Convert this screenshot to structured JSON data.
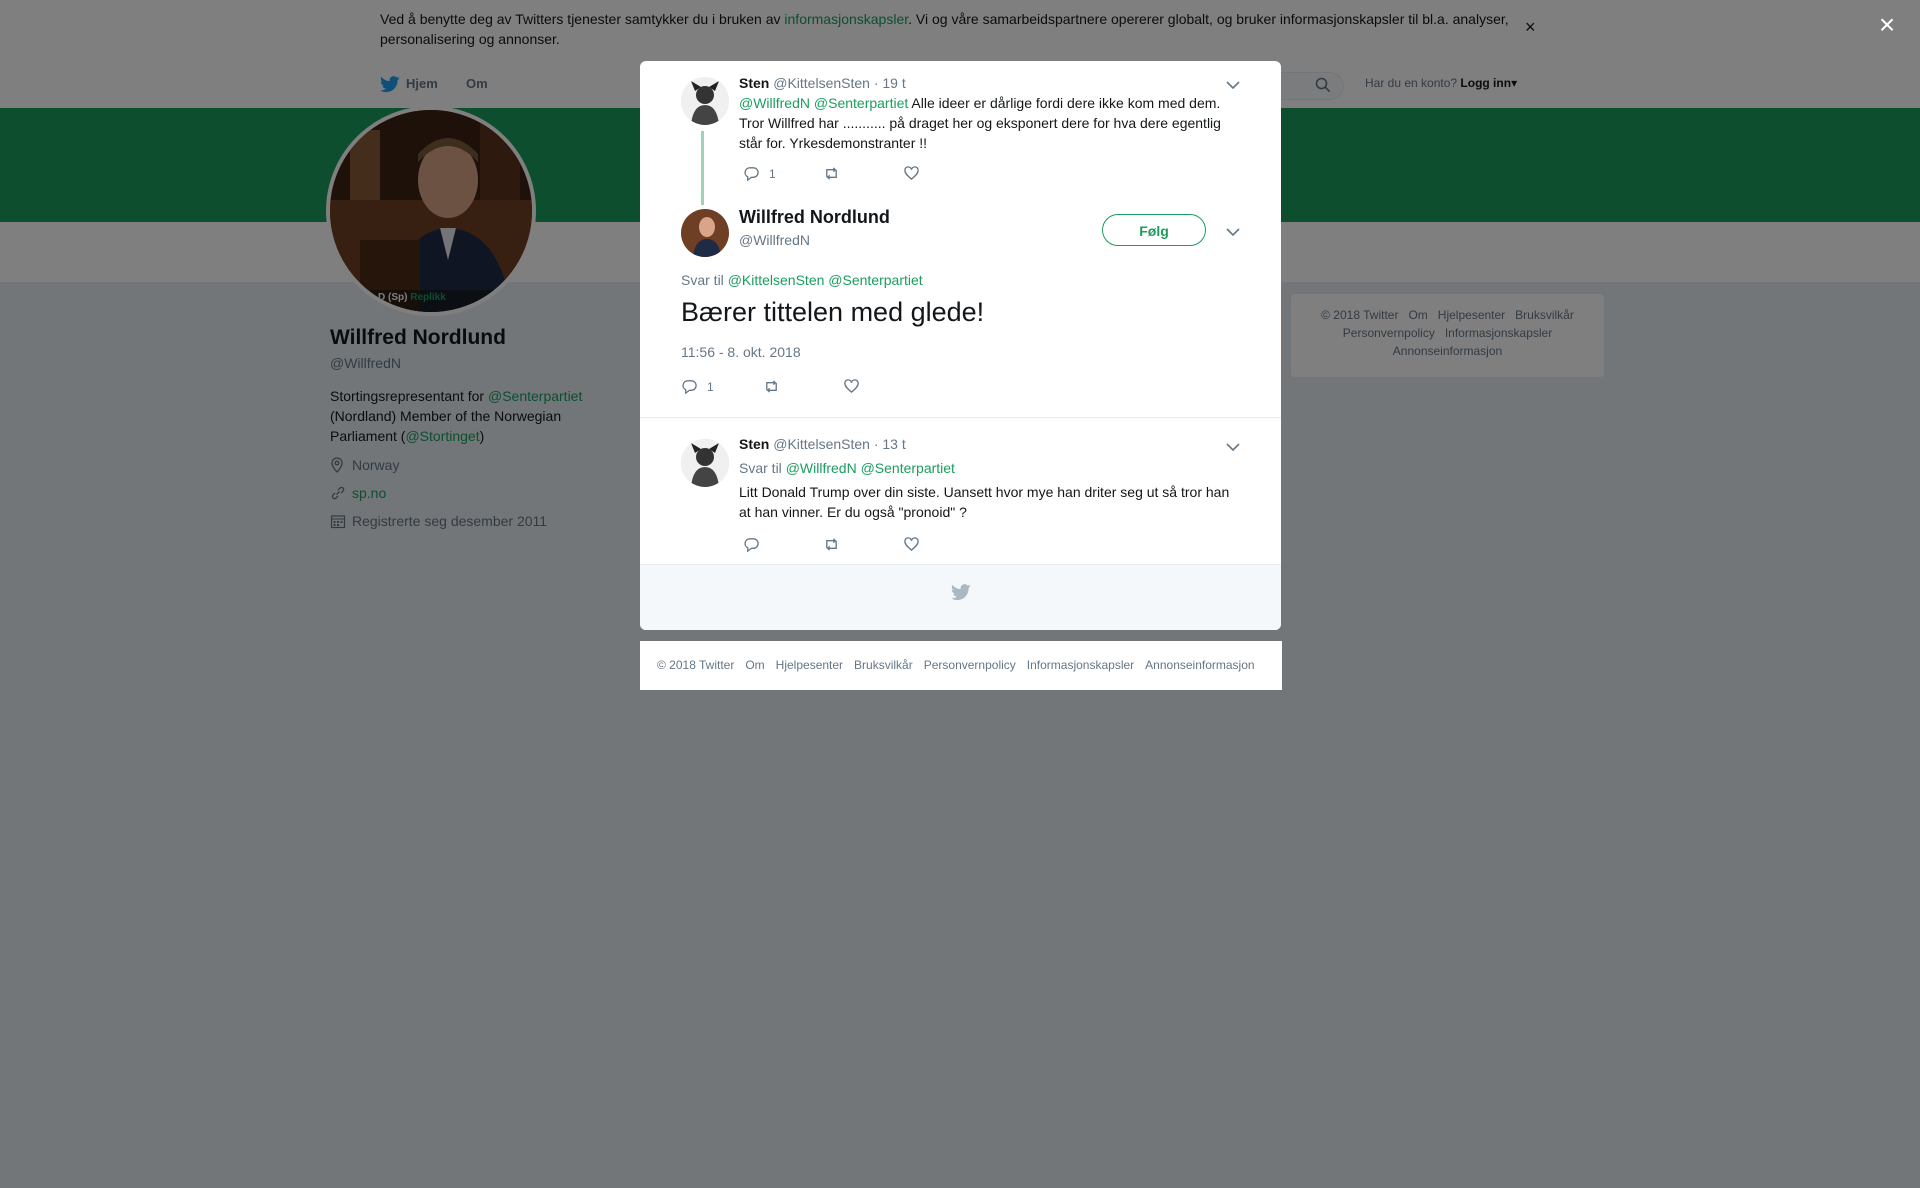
{
  "cookie_banner": {
    "text_before": "Ved å benytte deg av Twitters tjenester samtykker du i bruken av ",
    "link": "informasjonskapsler",
    "text_after": ". Vi og våre samarbeidspartnere opererer globalt, og bruker informasjonskapsler til bl.a. analyser, personalisering og annonser.",
    "close": "×"
  },
  "nav": {
    "home": "Hjem",
    "about": "Om",
    "login_question": "Har du en konto?",
    "login": "Logg inn"
  },
  "profile": {
    "avatar_caption": "D (Sp)",
    "avatar_caption_accent": "Replikk",
    "name": "Willfred Nordlund",
    "handle": "@WillfredN",
    "bio_1": "Stortingsrepresentant for ",
    "bio_link_1": "@Senterpartiet",
    "bio_2": " (Nordland) Member of the Norwegian Parliament (",
    "bio_link_2": "@Stortinget",
    "bio_3": ")",
    "location": "Norway",
    "website": "sp.no",
    "joined": "Registrerte seg desember 2011"
  },
  "side_footer": {
    "items": [
      "© 2018 Twitter",
      "Om",
      "Hjelpesenter",
      "Bruksvilkår",
      "Personvernpolicy",
      "Informasjonskapsler",
      "Annonseinformasjon"
    ]
  },
  "modal": {
    "close": "×",
    "parent_tweet": {
      "name": "Sten",
      "handle": "@KittelsenSten",
      "time": "· 19 t",
      "mention_1": "@WillfredN",
      "mention_2": "@Senterpartiet",
      "text": " Alle ideer er dårlige fordi dere ikke kom med dem. Tror Willfred har ........... på draget her og eksponert dere for hva dere egentlig står for. Yrkesdemonstranter !!",
      "replies": "1"
    },
    "main_tweet": {
      "name": "Willfred Nordlund",
      "handle": "@WillfredN",
      "follow": "Følg",
      "reply_to_label": "Svar til",
      "reply_to_1": "@KittelsenSten",
      "reply_to_2": "@Senterpartiet",
      "text": "Bærer tittelen med glede!",
      "timestamp": "11:56 - 8. okt. 2018",
      "replies": "1"
    },
    "reply_tweet": {
      "name": "Sten",
      "handle": "@KittelsenSten",
      "time": "· 13 t",
      "reply_to_label": "Svar til",
      "reply_to_1": "@WillfredN",
      "reply_to_2": "@Senterpartiet",
      "text": "Litt Donald Trump over din siste. Uansett hvor mye han driter seg ut så tror han at han vinner. Er du også \"pronoid\" ?"
    }
  },
  "footer": {
    "items": [
      "© 2018 Twitter",
      "Om",
      "Hjelpesenter",
      "Bruksvilkår",
      "Personvernpolicy",
      "Informasjonskapsler",
      "Annonseinformasjon"
    ]
  },
  "colors": {
    "brand": "#1b9d5f",
    "bird": "#1da1f2"
  }
}
